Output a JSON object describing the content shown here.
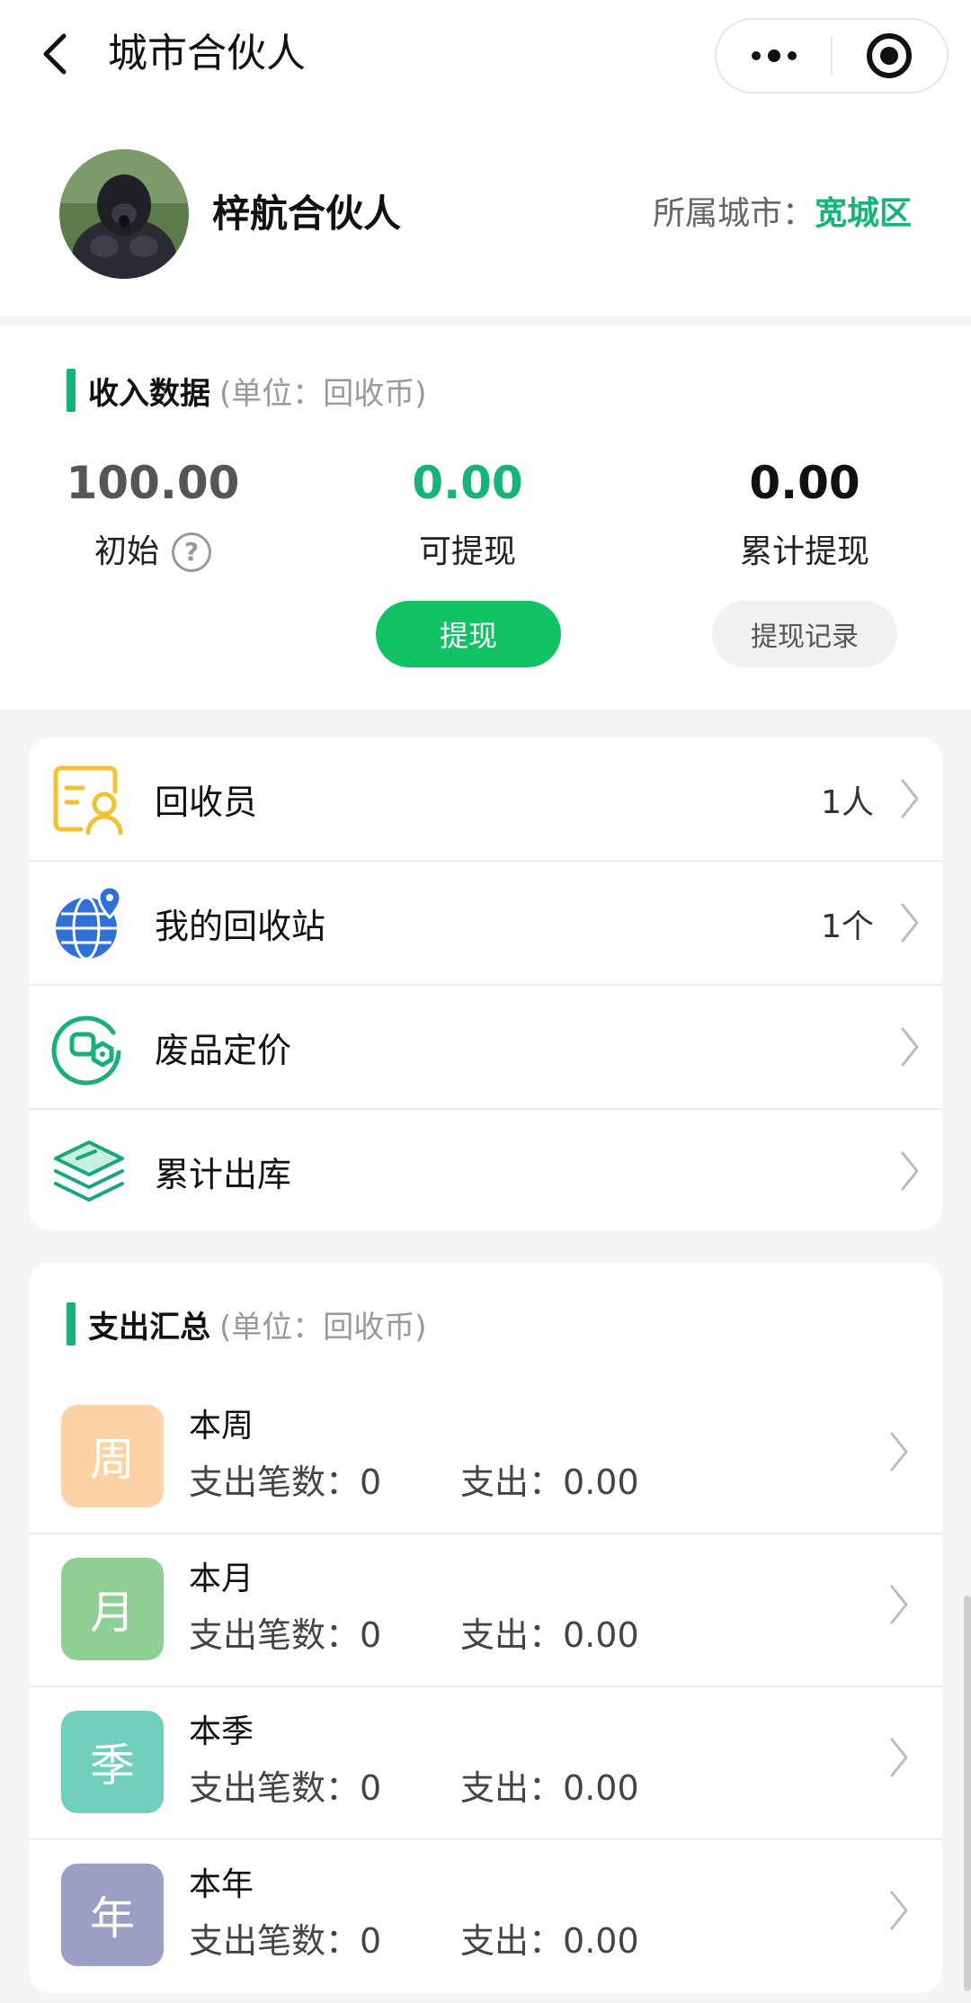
{
  "nav": {
    "title": "城市合伙人",
    "back_icon": "chevron-left-icon",
    "more_icon": "more-dots-icon",
    "close_icon": "target-circle-icon"
  },
  "profile": {
    "name": "梓航合伙人",
    "city_label": "所属城市：",
    "city_value": "宽城区"
  },
  "income": {
    "title": "收入数据",
    "unit": "(单位：回收币)",
    "initial": {
      "value": "100.00",
      "label": "初始"
    },
    "withdrawable": {
      "value": "0.00",
      "label": "可提现"
    },
    "total_withdrawn": {
      "value": "0.00",
      "label": "累计提现"
    },
    "withdraw_button": "提现",
    "record_button": "提现记录"
  },
  "menu": [
    {
      "label": "回收员",
      "count": "1人",
      "icon": "recycler-id-card-icon"
    },
    {
      "label": "我的回收站",
      "count": "1个",
      "icon": "globe-pin-icon"
    },
    {
      "label": "废品定价",
      "count": "",
      "icon": "price-tag-icon"
    },
    {
      "label": "累计出库",
      "count": "",
      "icon": "stacked-layers-icon"
    }
  ],
  "expense": {
    "title": "支出汇总",
    "unit": "(单位：回收币)",
    "rows": [
      {
        "badge": "周",
        "title": "本周",
        "count_label": "支出笔数：",
        "count": "0",
        "amount_label": "支出：",
        "amount": "0.00",
        "color": "#fdd3a6"
      },
      {
        "badge": "月",
        "title": "本月",
        "count_label": "支出笔数：",
        "count": "0",
        "amount_label": "支出：",
        "amount": "0.00",
        "color": "#8fcf94"
      },
      {
        "badge": "季",
        "title": "本季",
        "count_label": "支出笔数：",
        "count": "0",
        "amount_label": "支出：",
        "amount": "0.00",
        "color": "#6fcfba"
      },
      {
        "badge": "年",
        "title": "本年",
        "count_label": "支出笔数：",
        "count": "0",
        "amount_label": "支出：",
        "amount": "0.00",
        "color": "#9b9fc4"
      }
    ]
  },
  "colors": {
    "accent": "#16b47a",
    "button_green": "#13c265"
  }
}
